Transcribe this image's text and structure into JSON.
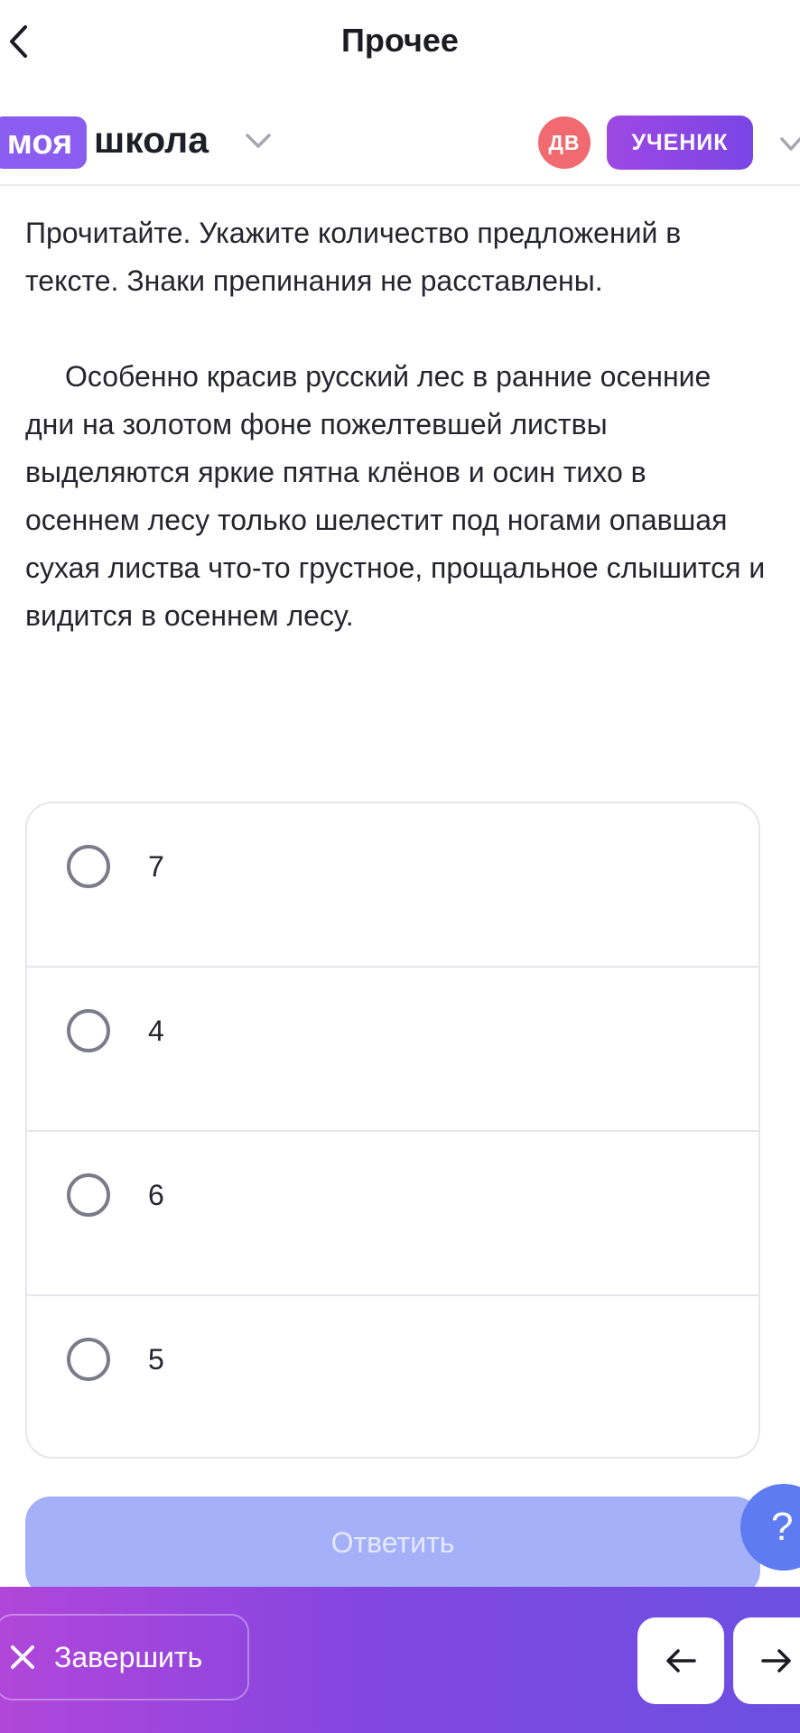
{
  "nav": {
    "title": "Прочее",
    "back_icon": "chevron-left-icon"
  },
  "header": {
    "logo_box": "моя",
    "logo_text": "школа",
    "avatar_initials": "ДВ",
    "role_label": "УЧЕНИК",
    "colors": {
      "logo": "#8a5cf0",
      "avatar": "#f06a6f",
      "badge": "#8a47e4"
    }
  },
  "question": {
    "instruction": "Прочитайте. Укажите количество предложений в тексте. Знаки препинания не расставлены.",
    "passage": "Особенно красив русский лес в ранние осенние дни на золотом фоне пожелтевшей листвы выделяются яркие пятна клёнов и осин тихо в осеннем лесу только шелестит под ногами опавшая сухая листва что-то грустное, прощальное слышится и видится в осеннем лесу."
  },
  "options": [
    "7",
    "4",
    "6",
    "5"
  ],
  "actions": {
    "submit_label": "Ответить",
    "help_label": "?",
    "finish_label": "Завершить"
  }
}
